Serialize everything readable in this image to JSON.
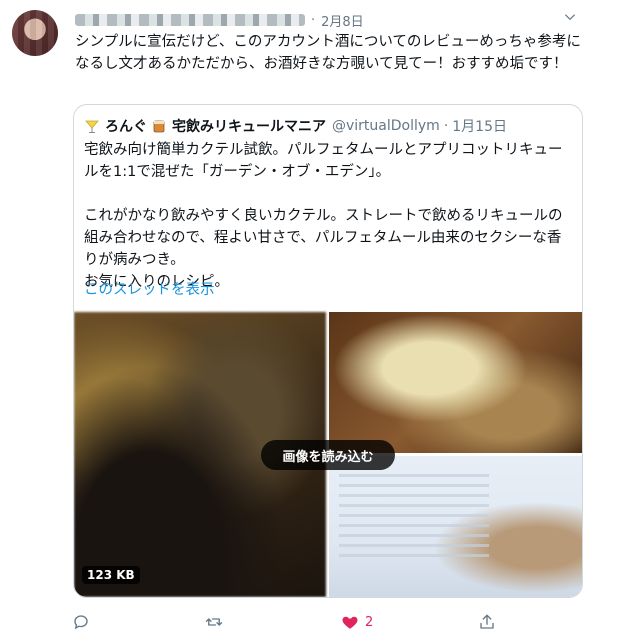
{
  "tweet": {
    "author_name_visible": "",
    "date": "2月8日",
    "text": "シンプルに宣伝だけど、このアカウント酒についてのレビューめっちゃ参考になるし文才あるかただから、お酒好きな方覗いて見てー！おすすめ垢です！",
    "like_count": "2"
  },
  "quote": {
    "name": "ろんぐ",
    "subname": "宅飲みリキュールマニア",
    "handle": "@virtualDollym",
    "date": "1月15日",
    "text": "宅飲み向け簡単カクテル試飲。パルフェタムールとアプリコットリキュールを1:1で混ぜた「ガーデン・オブ・エデン」。\n\nこれがかなり飲みやすく良いカクテル。ストレートで飲めるリキュールの組み合わせなので、程よい甘さで、パルフェタムール由来のセクシーな香りが病みつき。\nお気に入りのレシピ。",
    "thread_link": "このスレッドを表示",
    "load_images": "画像を読み込む",
    "size_badge": "123 KB"
  },
  "colors": {
    "link": "#1b95e0",
    "like": "#e0245e",
    "muted": "#657786"
  },
  "icons": [
    "chevron-down-icon",
    "reply-icon",
    "retweet-icon",
    "heart-icon",
    "share-icon",
    "cocktail-emoji-icon",
    "glass-emoji-icon"
  ]
}
